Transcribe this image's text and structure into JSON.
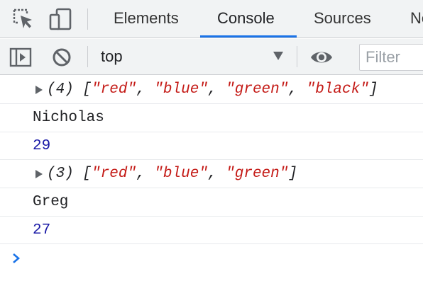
{
  "tabs": [
    {
      "label": "Elements",
      "active": false
    },
    {
      "label": "Console",
      "active": true
    },
    {
      "label": "Sources",
      "active": false
    },
    {
      "label": "Ne",
      "active": false
    }
  ],
  "toolbar": {
    "context": "top",
    "filter_placeholder": "Filter"
  },
  "console": {
    "entries": [
      {
        "type": "array",
        "count": "(4)",
        "items": [
          "red",
          "blue",
          "green",
          "black"
        ]
      },
      {
        "type": "string",
        "text": "Nicholas"
      },
      {
        "type": "number",
        "text": "29"
      },
      {
        "type": "array",
        "count": "(3)",
        "items": [
          "red",
          "blue",
          "green"
        ]
      },
      {
        "type": "string",
        "text": "Greg"
      },
      {
        "type": "number",
        "text": "27"
      }
    ]
  },
  "colors": {
    "accent": "#1a73e8",
    "string": "#c41a16",
    "number": "#1a1aa6"
  },
  "icons": [
    "inspect-element-icon",
    "device-toolbar-icon",
    "sidebar-toggle-icon",
    "clear-console-icon",
    "dropdown-arrow-icon",
    "live-expression-eye-icon",
    "expand-triangle-icon",
    "prompt-chevron-icon"
  ]
}
